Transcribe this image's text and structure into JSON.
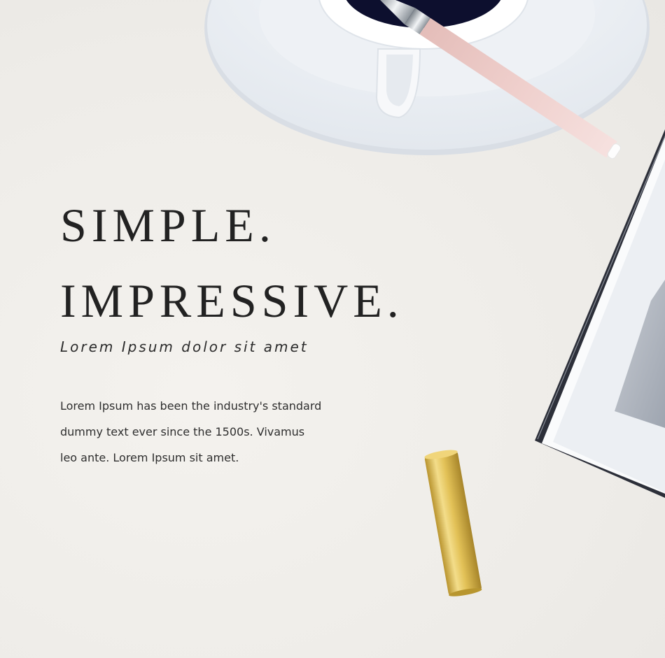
{
  "hero": {
    "headline_line1": "SIMPLE.",
    "headline_line2": "IMPRESSIVE.",
    "tagline": "Lorem Ipsum dolor sit amet",
    "body_line1": "Lorem Ipsum has been the industry's standard",
    "body_line2": "dummy text ever since the 1500s. Vivamus",
    "body_line3": "leo ante. Lorem Ipsum sit amet."
  },
  "colors": {
    "background": "#f1efeb",
    "text": "#222222",
    "pen_body": "#f1d4d2",
    "cap_gold": "#d9b94a",
    "coffee": "#0d0f2e"
  }
}
